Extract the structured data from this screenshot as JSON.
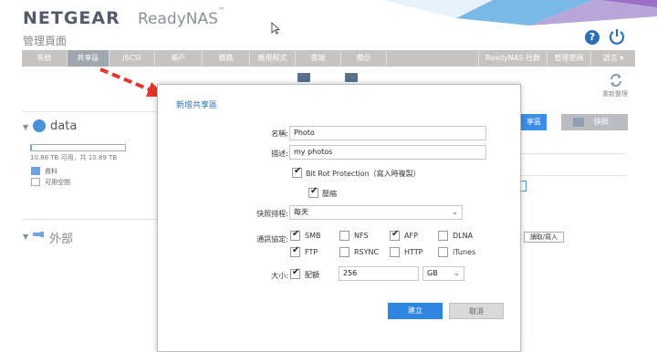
{
  "header": {
    "brand": "NETGEAR",
    "product": "ReadyNAS",
    "trademark": "™",
    "page_title": "管理頁面",
    "help_glyph": "?"
  },
  "nav": {
    "items": [
      {
        "label": "系統",
        "active": false
      },
      {
        "label": "共享區",
        "active": true
      },
      {
        "label": "iSCSI",
        "active": false
      },
      {
        "label": "帳戶",
        "active": false
      },
      {
        "label": "網路",
        "active": false
      },
      {
        "label": "應用程式",
        "active": false
      },
      {
        "label": "雲端",
        "active": false
      },
      {
        "label": "備份",
        "active": false
      }
    ],
    "right_items": [
      {
        "label": "ReadyNAS 社群"
      },
      {
        "label": "管理密碼"
      },
      {
        "label": "語言 ▾"
      }
    ]
  },
  "background": {
    "refresh_label": "重新整理",
    "volume": {
      "name": "data",
      "capacity_text": "10.86 TB 可用，共 10.89 TB",
      "used_fraction": 0.003,
      "legend_data": "資料",
      "legend_free": "可用空間"
    },
    "external": {
      "name": "外部"
    },
    "import_label": "讀取/寫入",
    "share_button": "享區",
    "snapshot_button": "快照"
  },
  "modal": {
    "title": "新增共享區",
    "name_label": "名稱:",
    "name_value": "Photo",
    "desc_label": "描述:",
    "desc_value": "my photos",
    "bitrot_label": "Bit Rot Protection（寫入時複製）",
    "bitrot_checked": true,
    "compress_label": "壓縮",
    "compress_checked": true,
    "schedule_label": "快照排程:",
    "schedule_value": "每天",
    "protocol_label": "通訊協定:",
    "protocols": [
      {
        "label": "SMB",
        "checked": true
      },
      {
        "label": "NFS",
        "checked": false
      },
      {
        "label": "AFP",
        "checked": true
      },
      {
        "label": "DLNA",
        "checked": false
      },
      {
        "label": "FTP",
        "checked": true
      },
      {
        "label": "RSYNC",
        "checked": false
      },
      {
        "label": "HTTP",
        "checked": false
      },
      {
        "label": "iTunes",
        "checked": false
      }
    ],
    "size_label": "大小:",
    "quota_label": "配額",
    "quota_checked": true,
    "quota_value": "256",
    "unit_value": "GB",
    "create_button": "建立",
    "cancel_button": "取消"
  },
  "colors": {
    "accent": "#2f86e0",
    "nav_bg": "#c6c3c0",
    "nav_active": "#a0a7ae",
    "brand": "#555a6a",
    "annotation_arrow": "#e8352b"
  }
}
